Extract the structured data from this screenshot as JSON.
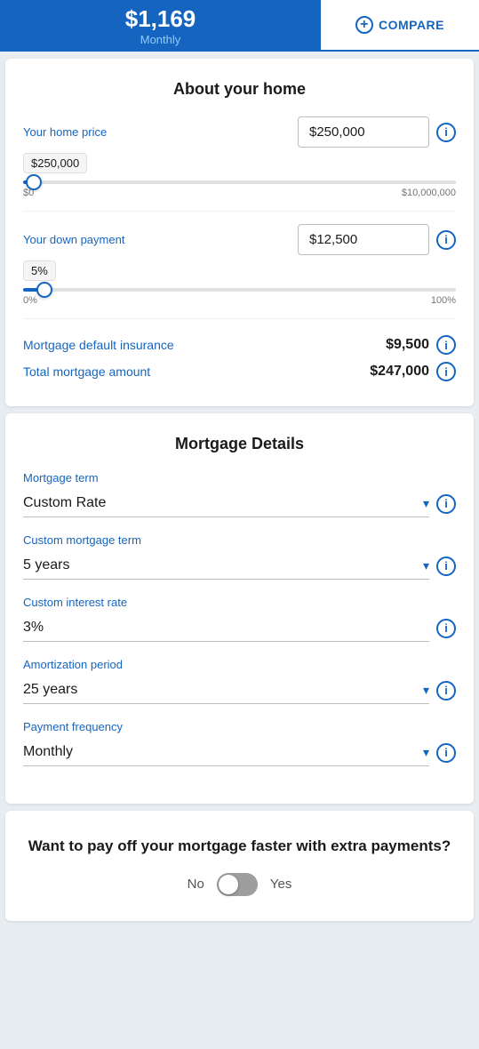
{
  "header": {
    "amount": "$1,169",
    "frequency_label": "Monthly",
    "compare_label": "COMPARE"
  },
  "about_home": {
    "title": "About your home",
    "home_price_label": "Your home price",
    "home_price_value": "$250,000",
    "home_price_slider_tag": "$250,000",
    "home_price_min": "$0",
    "home_price_max": "$10,000,000",
    "home_price_pct": 2.5,
    "down_payment_label": "Your down payment",
    "down_payment_value": "$12,500",
    "down_payment_tag": "5%",
    "down_payment_min": "0%",
    "down_payment_max": "100%",
    "down_payment_pct": 5,
    "insurance_label": "Mortgage default insurance",
    "insurance_value": "$9,500",
    "total_label": "Total mortgage amount",
    "total_value": "$247,000"
  },
  "mortgage_details": {
    "title": "Mortgage Details",
    "term_label": "Mortgage term",
    "term_value": "Custom Rate",
    "custom_term_label": "Custom mortgage term",
    "custom_term_value": "5 years",
    "interest_rate_label": "Custom interest rate",
    "interest_rate_value": "3%",
    "amortization_label": "Amortization period",
    "amortization_value": "25 years",
    "payment_freq_label": "Payment frequency",
    "payment_freq_value": "Monthly"
  },
  "extra_payments": {
    "title": "Want to pay off your mortgage faster with extra payments?",
    "no_label": "No",
    "yes_label": "Yes"
  },
  "icons": {
    "info": "i",
    "chevron_down": "▾",
    "plus": "+"
  }
}
